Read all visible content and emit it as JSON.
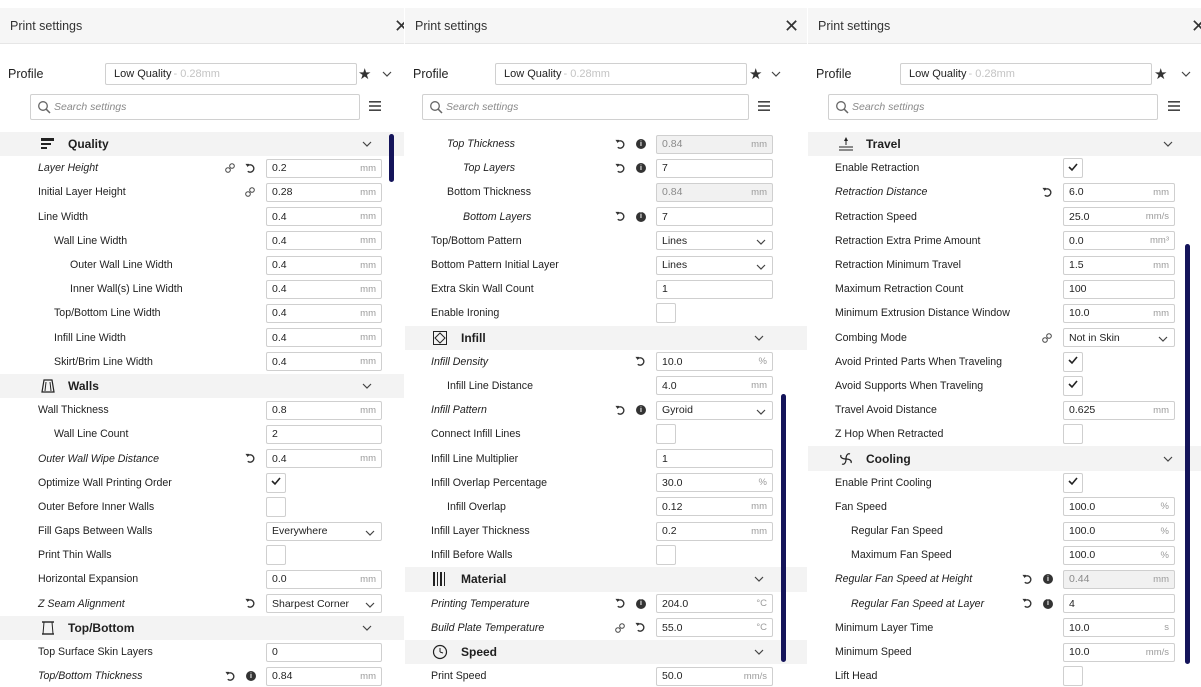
{
  "panels": [
    {
      "title": "Print settings",
      "profile_label": "Profile",
      "profile_name": "Low Quality",
      "profile_sub": " - 0.28mm",
      "search_placeholder": "Search settings",
      "rows": [
        {
          "type": "cat",
          "icon": "quality",
          "label": "Quality"
        },
        {
          "label": "Layer Height",
          "italic": true,
          "link": true,
          "reset": true,
          "value": "0.2",
          "unit": "mm"
        },
        {
          "label": "Initial Layer Height",
          "link": true,
          "value": "0.28",
          "unit": "mm"
        },
        {
          "label": "Line Width",
          "value": "0.4",
          "unit": "mm"
        },
        {
          "label": "Wall Line Width",
          "indent": 1,
          "value": "0.4",
          "unit": "mm"
        },
        {
          "label": "Outer Wall Line Width",
          "indent": 2,
          "value": "0.4",
          "unit": "mm"
        },
        {
          "label": "Inner Wall(s) Line Width",
          "indent": 2,
          "value": "0.4",
          "unit": "mm"
        },
        {
          "label": "Top/Bottom Line Width",
          "indent": 1,
          "value": "0.4",
          "unit": "mm"
        },
        {
          "label": "Infill Line Width",
          "indent": 1,
          "value": "0.4",
          "unit": "mm"
        },
        {
          "label": "Skirt/Brim Line Width",
          "indent": 1,
          "value": "0.4",
          "unit": "mm"
        },
        {
          "type": "cat",
          "icon": "walls",
          "label": "Walls"
        },
        {
          "label": "Wall Thickness",
          "value": "0.8",
          "unit": "mm"
        },
        {
          "label": "Wall Line Count",
          "indent": 1,
          "value": "2",
          "unit": ""
        },
        {
          "label": "Outer Wall Wipe Distance",
          "italic": true,
          "reset": true,
          "value": "0.4",
          "unit": "mm"
        },
        {
          "label": "Optimize Wall Printing Order",
          "check": true
        },
        {
          "label": "Outer Before Inner Walls",
          "check": false
        },
        {
          "label": "Fill Gaps Between Walls",
          "select": "Everywhere"
        },
        {
          "label": "Print Thin Walls",
          "check": false
        },
        {
          "label": "Horizontal Expansion",
          "value": "0.0",
          "unit": "mm"
        },
        {
          "label": "Z Seam Alignment",
          "italic": true,
          "reset": true,
          "select": "Sharpest Corner"
        },
        {
          "type": "cat",
          "icon": "topbottom",
          "label": "Top/Bottom"
        },
        {
          "label": "Top Surface Skin Layers",
          "value": "0",
          "unit": ""
        },
        {
          "label": "Top/Bottom Thickness",
          "italic": true,
          "reset": true,
          "info": true,
          "value": "0.84",
          "unit": "mm"
        }
      ]
    },
    {
      "title": "Print settings",
      "profile_label": "Profile",
      "profile_name": "Low Quality",
      "profile_sub": " - 0.28mm",
      "search_placeholder": "Search settings",
      "rows": [
        {
          "label": "Top Thickness",
          "italic": true,
          "indent": 1,
          "reset": true,
          "info": true,
          "value": "0.84",
          "unit": "mm",
          "disabled": true
        },
        {
          "label": "Top Layers",
          "italic": true,
          "indent": 2,
          "reset": true,
          "info": true,
          "value": "7",
          "unit": ""
        },
        {
          "label": "Bottom Thickness",
          "indent": 1,
          "value": "0.84",
          "unit": "mm",
          "disabled": true
        },
        {
          "label": "Bottom Layers",
          "italic": true,
          "indent": 2,
          "reset": true,
          "info": true,
          "value": "7",
          "unit": ""
        },
        {
          "label": "Top/Bottom Pattern",
          "select": "Lines"
        },
        {
          "label": "Bottom Pattern Initial Layer",
          "select": "Lines"
        },
        {
          "label": "Extra Skin Wall Count",
          "value": "1",
          "unit": ""
        },
        {
          "label": "Enable Ironing",
          "check": false
        },
        {
          "type": "cat",
          "icon": "infill",
          "label": "Infill"
        },
        {
          "label": "Infill Density",
          "italic": true,
          "reset": true,
          "value": "10.0",
          "unit": "%"
        },
        {
          "label": "Infill Line Distance",
          "indent": 1,
          "value": "4.0",
          "unit": "mm"
        },
        {
          "label": "Infill Pattern",
          "italic": true,
          "reset": true,
          "info": true,
          "select": "Gyroid"
        },
        {
          "label": "Connect Infill Lines",
          "check": false
        },
        {
          "label": "Infill Line Multiplier",
          "value": "1",
          "unit": ""
        },
        {
          "label": "Infill Overlap Percentage",
          "value": "30.0",
          "unit": "%"
        },
        {
          "label": "Infill Overlap",
          "indent": 1,
          "value": "0.12",
          "unit": "mm"
        },
        {
          "label": "Infill Layer Thickness",
          "value": "0.2",
          "unit": "mm"
        },
        {
          "label": "Infill Before Walls",
          "check": false
        },
        {
          "type": "cat",
          "icon": "material",
          "label": "Material"
        },
        {
          "label": "Printing Temperature",
          "italic": true,
          "reset": true,
          "info": true,
          "value": "204.0",
          "unit": "°C"
        },
        {
          "label": "Build Plate Temperature",
          "italic": true,
          "link": true,
          "reset": true,
          "value": "55.0",
          "unit": "°C"
        },
        {
          "type": "cat",
          "icon": "speed",
          "label": "Speed"
        },
        {
          "label": "Print Speed",
          "value": "50.0",
          "unit": "mm/s"
        }
      ]
    },
    {
      "title": "Print settings",
      "profile_label": "Profile",
      "profile_name": "Low Quality",
      "profile_sub": " - 0.28mm",
      "search_placeholder": "Search settings",
      "rows": [
        {
          "type": "cat",
          "icon": "travel",
          "label": "Travel"
        },
        {
          "label": "Enable Retraction",
          "check": true
        },
        {
          "label": "Retraction Distance",
          "italic": true,
          "reset": true,
          "value": "6.0",
          "unit": "mm"
        },
        {
          "label": "Retraction Speed",
          "value": "25.0",
          "unit": "mm/s"
        },
        {
          "label": "Retraction Extra Prime Amount",
          "value": "0.0",
          "unit": "mm³"
        },
        {
          "label": "Retraction Minimum Travel",
          "value": "1.5",
          "unit": "mm"
        },
        {
          "label": "Maximum Retraction Count",
          "value": "100",
          "unit": ""
        },
        {
          "label": "Minimum Extrusion Distance Window",
          "value": "10.0",
          "unit": "mm"
        },
        {
          "label": "Combing Mode",
          "link": true,
          "select": "Not in Skin"
        },
        {
          "label": "Avoid Printed Parts When Traveling",
          "check": true
        },
        {
          "label": "Avoid Supports When Traveling",
          "check": true
        },
        {
          "label": "Travel Avoid Distance",
          "value": "0.625",
          "unit": "mm"
        },
        {
          "label": "Z Hop When Retracted",
          "check": false
        },
        {
          "type": "cat",
          "icon": "cooling",
          "label": "Cooling"
        },
        {
          "label": "Enable Print Cooling",
          "check": true
        },
        {
          "label": "Fan Speed",
          "value": "100.0",
          "unit": "%"
        },
        {
          "label": "Regular Fan Speed",
          "indent": 1,
          "value": "100.0",
          "unit": "%"
        },
        {
          "label": "Maximum Fan Speed",
          "indent": 1,
          "value": "100.0",
          "unit": "%"
        },
        {
          "label": "Regular Fan Speed at Height",
          "italic": true,
          "reset": true,
          "info": true,
          "value": "0.44",
          "unit": "mm",
          "disabled": true
        },
        {
          "label": "Regular Fan Speed at Layer",
          "italic": true,
          "indent": 1,
          "reset": true,
          "info": true,
          "value": "4",
          "unit": ""
        },
        {
          "label": "Minimum Layer Time",
          "value": "10.0",
          "unit": "s"
        },
        {
          "label": "Minimum Speed",
          "value": "10.0",
          "unit": "mm/s"
        },
        {
          "label": "Lift Head",
          "check": false
        }
      ]
    }
  ],
  "colors": {
    "accent": "#14145a",
    "header_bg": "#f6f6f6",
    "category_bg": "#f3f3f3"
  }
}
